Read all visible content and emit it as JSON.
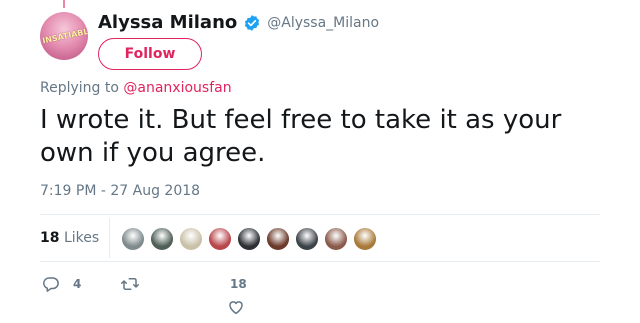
{
  "author": {
    "name": "Alyssa Milano",
    "handle": "@Alyssa_Milano",
    "avatar_text": "INSATIABLE",
    "verified": true
  },
  "follow_label": "Follow",
  "reply": {
    "prefix": "Replying to",
    "mention": "@ananxiousfan"
  },
  "tweet_text": "I wrote it. But feel free to take it as your own if you agree.",
  "timestamp": "7:19 PM - 27 Aug 2018",
  "stats": {
    "likes_count": "18",
    "likes_label": "Likes"
  },
  "likers": [
    {
      "color": "#7f8a8c"
    },
    {
      "color": "#4f5f57"
    },
    {
      "color": "#c9c0a8"
    },
    {
      "color": "#b8464b"
    },
    {
      "color": "#2d3135"
    },
    {
      "color": "#6b3a2a"
    },
    {
      "color": "#3c4348"
    },
    {
      "color": "#8a5a4a"
    },
    {
      "color": "#a87a3a"
    }
  ],
  "actions": {
    "reply_count": "4",
    "retweet_count": "",
    "like_count": "18"
  },
  "colors": {
    "accent": "#e0245e",
    "verified": "#1da1f2",
    "secondary_text": "#657786"
  },
  "icons": [
    "verified-badge-icon",
    "reply-icon",
    "retweet-icon",
    "like-icon"
  ]
}
